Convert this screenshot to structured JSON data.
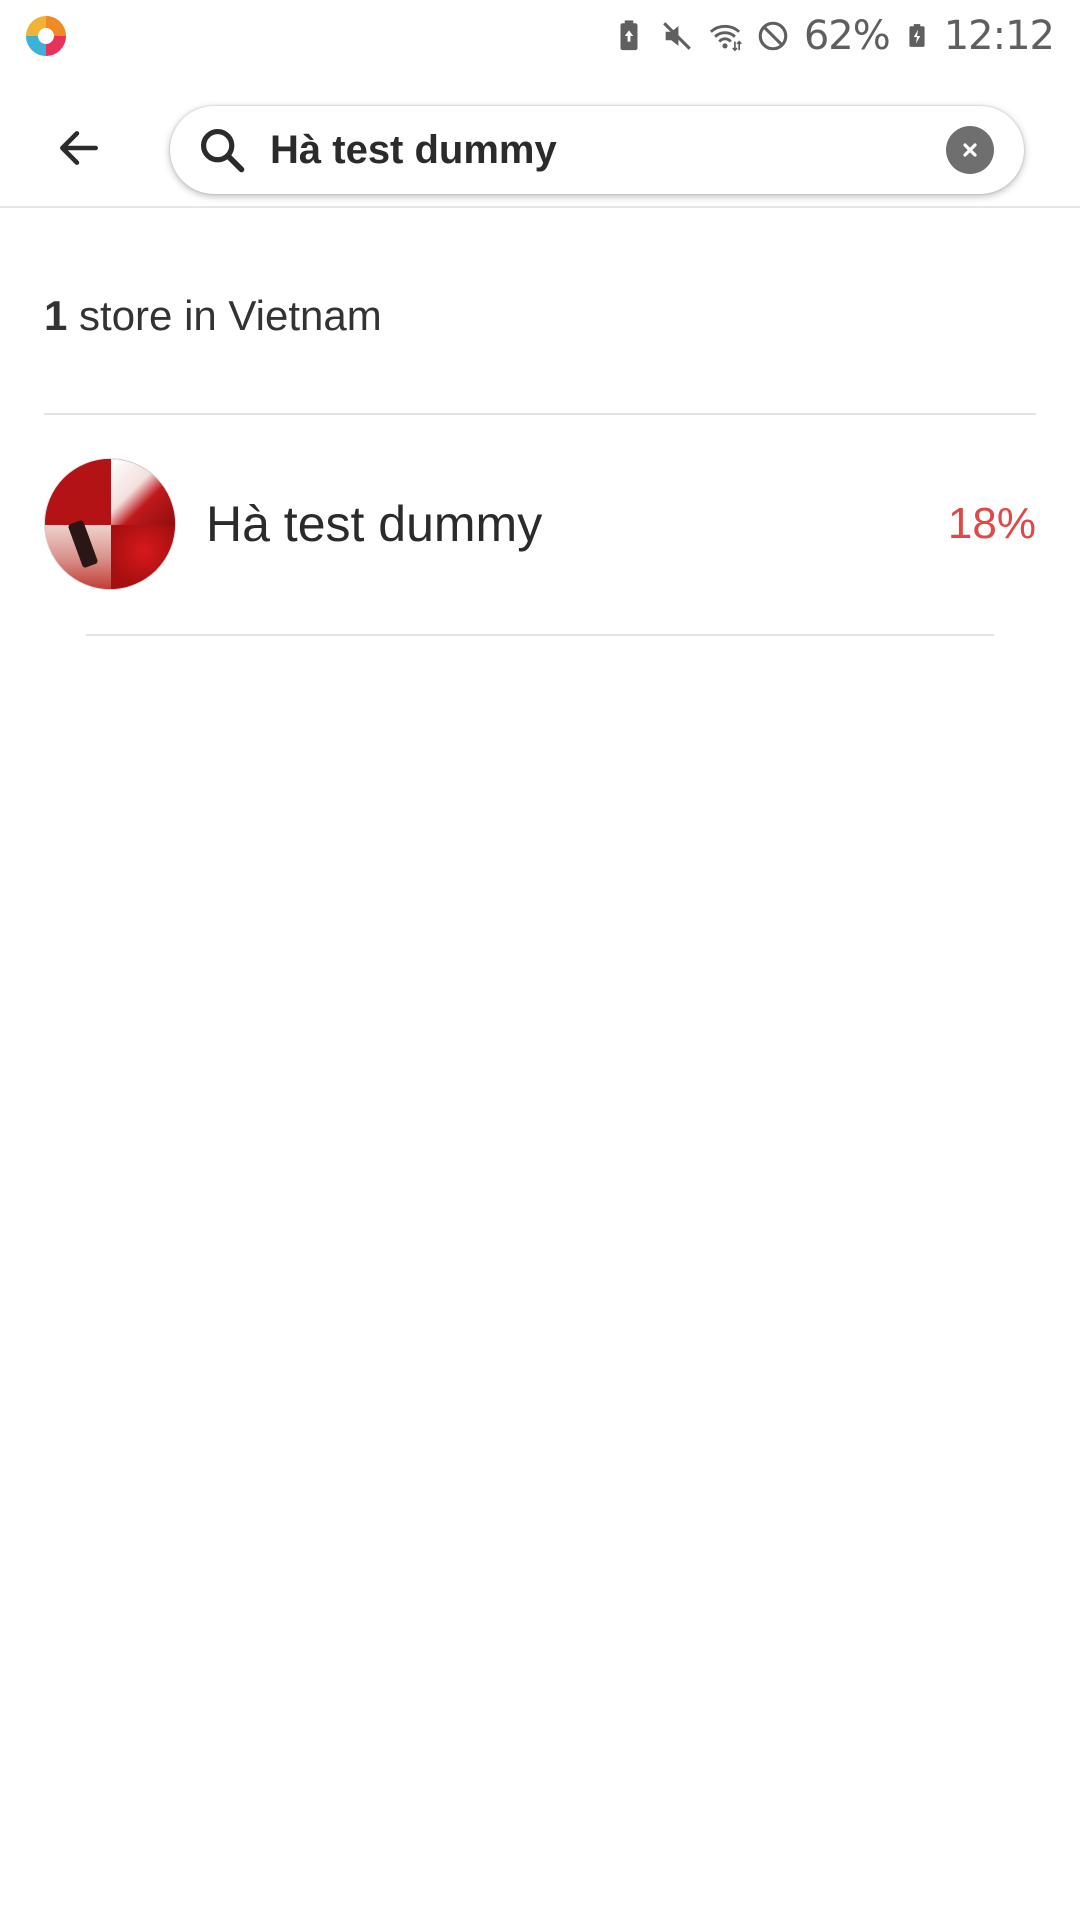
{
  "status_bar": {
    "battery_percent": "62%",
    "time": "12:12",
    "icons": [
      "app-logo-icon",
      "battery-saver-icon",
      "mute-icon",
      "wifi-icon",
      "do-not-disturb-icon",
      "battery-icon"
    ]
  },
  "search": {
    "value": "Hà test dummy",
    "icons": [
      "back-arrow-icon",
      "search-icon",
      "clear-icon"
    ]
  },
  "results": {
    "count": "1",
    "label": " store in Vietnam"
  },
  "stores": [
    {
      "name": "Hà test dummy",
      "discount": "18%",
      "discount_color": "#e04848"
    }
  ]
}
